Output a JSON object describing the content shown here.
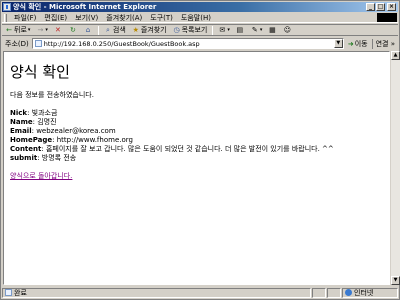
{
  "window": {
    "title": "양식 확인 - Microsoft Internet Explorer"
  },
  "menu": [
    "파일(F)",
    "편집(E)",
    "보기(V)",
    "즐겨찾기(A)",
    "도구(T)",
    "도움말(H)"
  ],
  "toolbar": {
    "back": "뒤로",
    "search": "검색",
    "favorites": "즐겨찾기",
    "history": "목록보기"
  },
  "address": {
    "label": "주소(D)",
    "url": "http://192.168.0.250/GuestBook/GuestBook.asp",
    "go": "이동",
    "links": "연결"
  },
  "page": {
    "heading": "양식 확인",
    "intro": "다음 정보를 전송하였습니다.",
    "fields": [
      {
        "label": "Nick",
        "value": "빛과소금"
      },
      {
        "label": "Name",
        "value": "김명진"
      },
      {
        "label": "Email",
        "value": "webzealer@korea.com"
      },
      {
        "label": "HomePage",
        "value": "http://www.fhome.org"
      },
      {
        "label": "Content",
        "value": "홈페이지를 잘 보고 갑니다. 많은 도움이 되었던 것 같습니다. 더 많은 발전이 있기를 바랍니다. ^^"
      },
      {
        "label": "submit",
        "value": "방명록 전송"
      }
    ],
    "back_link": "양식으로 돌아갑니다."
  },
  "status": {
    "text": "완료",
    "zone": "인터넷"
  }
}
